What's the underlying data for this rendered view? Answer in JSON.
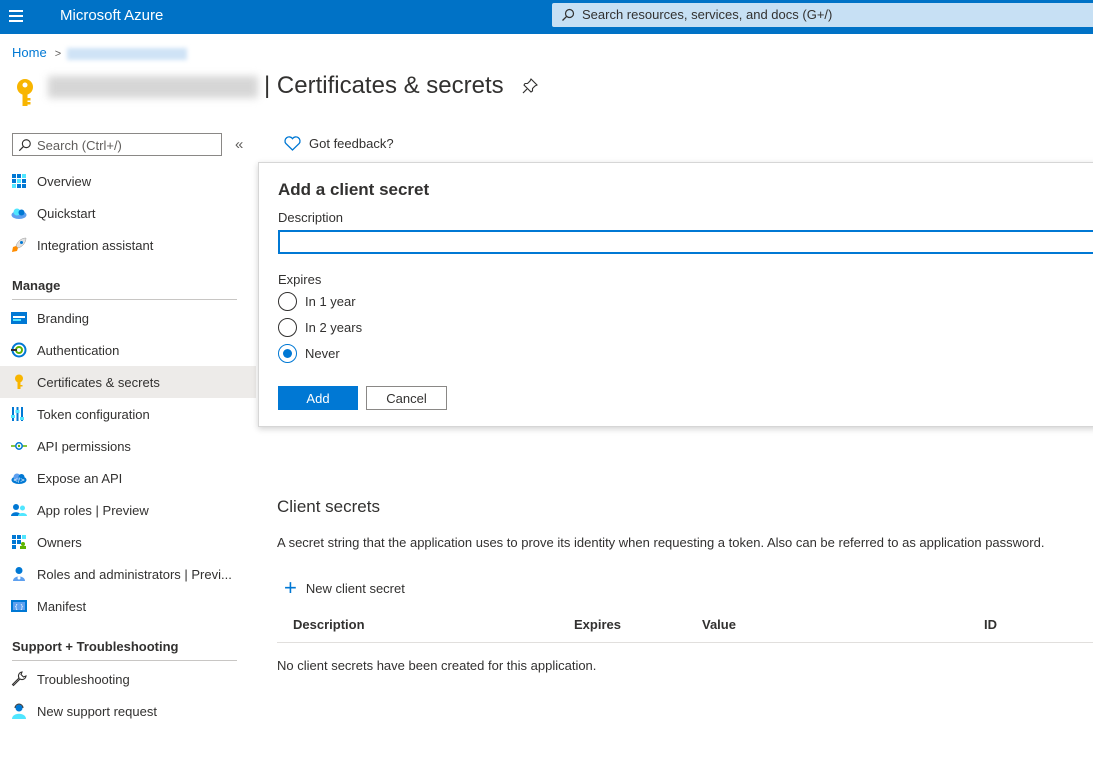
{
  "topbar": {
    "brand": "Microsoft Azure",
    "search_placeholder": "Search resources, services, and docs (G+/)"
  },
  "breadcrumb": {
    "home": "Home",
    "separator": ">"
  },
  "page": {
    "title": "| Certificates & secrets"
  },
  "nav": {
    "search_placeholder": "Search (Ctrl+/)",
    "collapse_glyph": "«",
    "top_items": [
      {
        "label": "Overview",
        "icon": "overview-icon"
      },
      {
        "label": "Quickstart",
        "icon": "quickstart-icon"
      },
      {
        "label": "Integration assistant",
        "icon": "rocket-icon"
      }
    ],
    "manage_heading": "Manage",
    "manage_items": [
      {
        "label": "Branding",
        "icon": "branding-icon"
      },
      {
        "label": "Authentication",
        "icon": "authentication-icon"
      },
      {
        "label": "Certificates & secrets",
        "icon": "key-icon",
        "selected": true
      },
      {
        "label": "Token configuration",
        "icon": "token-icon"
      },
      {
        "label": "API permissions",
        "icon": "api-permissions-icon"
      },
      {
        "label": "Expose an API",
        "icon": "expose-api-icon"
      },
      {
        "label": "App roles | Preview",
        "icon": "app-roles-icon"
      },
      {
        "label": "Owners",
        "icon": "owners-icon"
      },
      {
        "label": "Roles and administrators | Previ...",
        "icon": "roles-admin-icon"
      },
      {
        "label": "Manifest",
        "icon": "manifest-icon"
      }
    ],
    "support_heading": "Support + Troubleshooting",
    "support_items": [
      {
        "label": "Troubleshooting",
        "icon": "wrench-icon"
      },
      {
        "label": "New support request",
        "icon": "support-person-icon"
      }
    ]
  },
  "toolbar": {
    "feedback": "Got feedback?"
  },
  "panel": {
    "title": "Add a client secret",
    "description_label": "Description",
    "description_value": "",
    "expires_label": "Expires",
    "options": [
      {
        "label": "In 1 year",
        "checked": false
      },
      {
        "label": "In 2 years",
        "checked": false
      },
      {
        "label": "Never",
        "checked": true
      }
    ],
    "add_label": "Add",
    "cancel_label": "Cancel"
  },
  "client_secrets": {
    "title": "Client secrets",
    "description": "A secret string that the application uses to prove its identity when requesting a token. Also can be referred to as application password.",
    "new_label": "New client secret",
    "columns": [
      "Description",
      "Expires",
      "Value",
      "ID"
    ],
    "empty_message": "No client secrets have been created for this application."
  },
  "colors": {
    "topbar": "#0072c6",
    "accent": "#0078d4",
    "selected_bg": "#edebe9"
  }
}
